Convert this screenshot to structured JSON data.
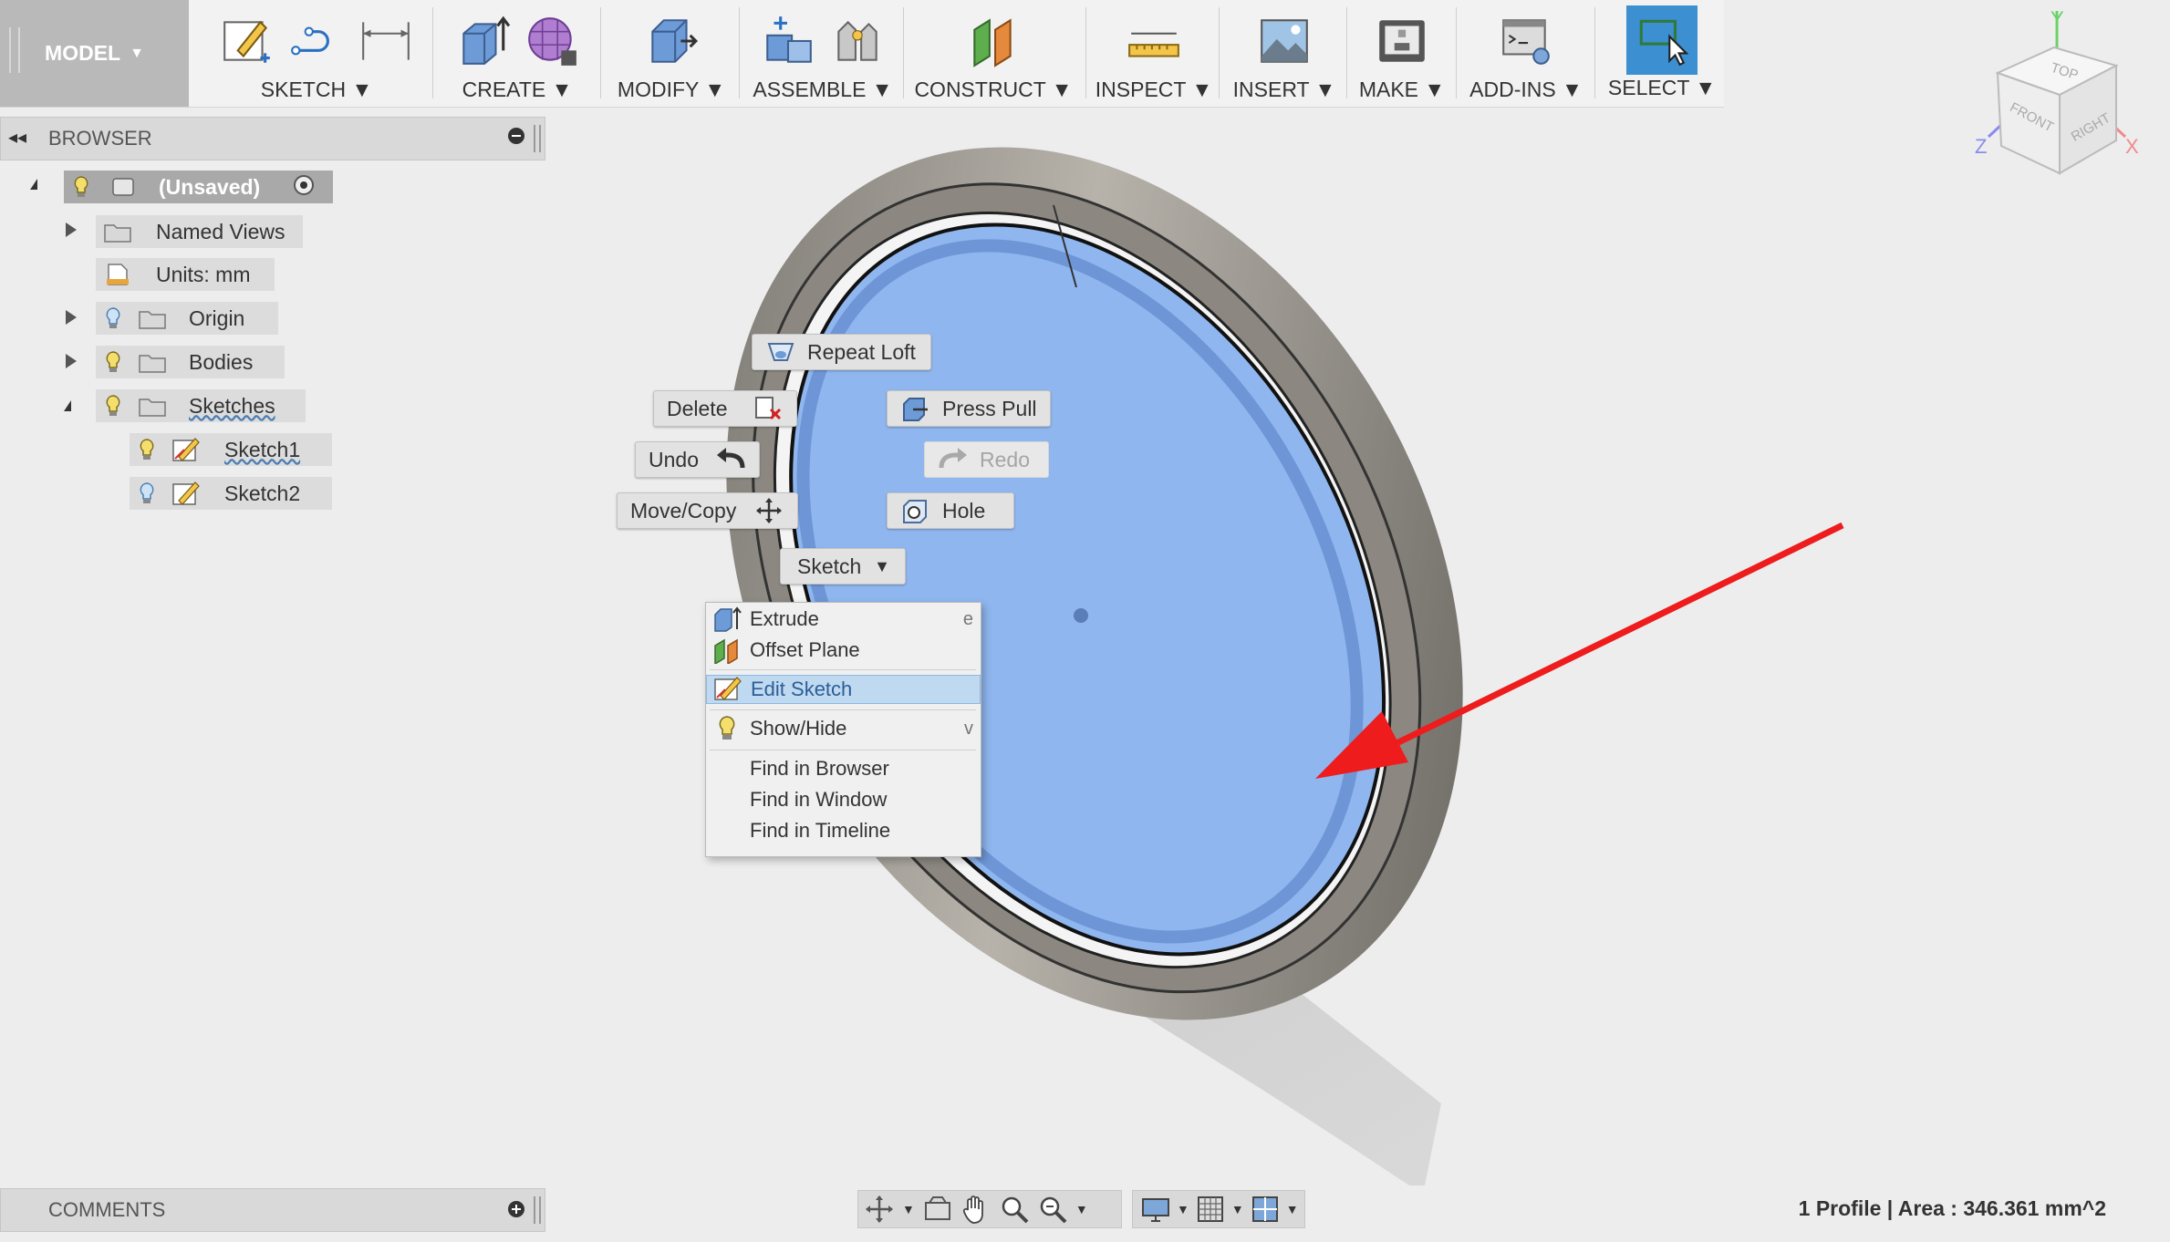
{
  "toolbar": {
    "model_label": "MODEL",
    "sketch_label": "SKETCH",
    "create_label": "CREATE",
    "modify_label": "MODIFY",
    "assemble_label": "ASSEMBLE",
    "construct_label": "CONSTRUCT",
    "inspect_label": "INSPECT",
    "insert_label": "INSERT",
    "make_label": "MAKE",
    "addins_label": "ADD-INS",
    "select_label": "SELECT"
  },
  "browser": {
    "title": "BROWSER",
    "root_label": "(Unsaved)",
    "items": [
      {
        "label": "Named Views"
      },
      {
        "label": "Units: mm"
      },
      {
        "label": "Origin"
      },
      {
        "label": "Bodies"
      },
      {
        "label": "Sketches"
      },
      {
        "label": "Sketch1"
      },
      {
        "label": "Sketch2"
      }
    ]
  },
  "marking_menu": {
    "repeat_loft": "Repeat Loft",
    "delete": "Delete",
    "press_pull": "Press Pull",
    "undo": "Undo",
    "redo": "Redo",
    "move_copy": "Move/Copy",
    "hole": "Hole",
    "sketch": "Sketch"
  },
  "context_menu": {
    "items": [
      {
        "label": "Extrude",
        "shortcut": "e"
      },
      {
        "label": "Offset Plane",
        "shortcut": ""
      },
      {
        "label": "Edit Sketch",
        "shortcut": ""
      },
      {
        "label": "Show/Hide",
        "shortcut": "v"
      },
      {
        "label": "Find in Browser",
        "shortcut": ""
      },
      {
        "label": "Find in Window",
        "shortcut": ""
      },
      {
        "label": "Find in Timeline",
        "shortcut": ""
      }
    ]
  },
  "viewcube": {
    "top": "TOP",
    "front": "FRONT",
    "right": "RIGHT",
    "axis_x": "X",
    "axis_y": "Y",
    "axis_z": "Z"
  },
  "comments": {
    "title": "COMMENTS"
  },
  "status": {
    "text": "1 Profile | Area : 346.361 mm^2"
  },
  "colors": {
    "profile_fill": "#8fb6ef",
    "ring_metal": "#8c8881",
    "arrow": "#ee1c1c",
    "select_accent": "#3c8fd0"
  }
}
